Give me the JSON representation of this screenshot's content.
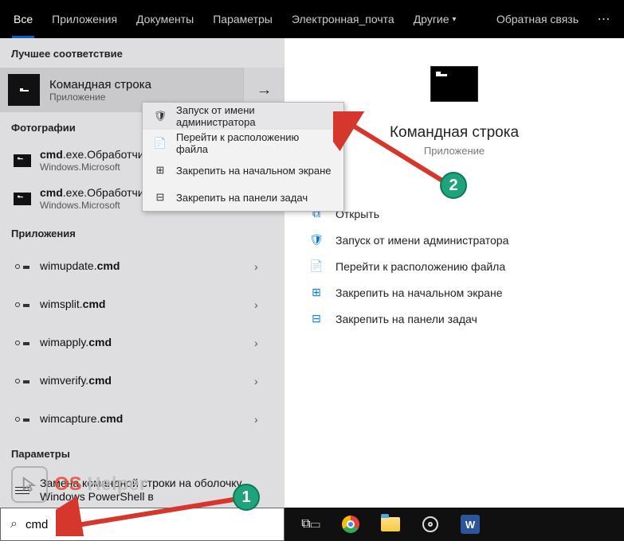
{
  "topbar": {
    "tabs": [
      "Все",
      "Приложения",
      "Документы",
      "Параметры",
      "Электронная_почта",
      "Другие"
    ],
    "feedback": "Обратная связь"
  },
  "sections": {
    "best": "Лучшее соответствие",
    "photos": "Фотографии",
    "apps": "Приложения",
    "settings": "Параметры"
  },
  "best": {
    "title": "Командная строка",
    "subtitle": "Приложение"
  },
  "photos": [
    {
      "t1": "cmd",
      "t2": ".exe.Обработчи",
      "sub": "Windows.Microsoft"
    },
    {
      "t1": "cmd",
      "t2": ".exe.Обработчик команд",
      "sub": "Windows.Microsoft"
    }
  ],
  "apps": [
    {
      "p": "wimupdate.",
      "s": "cmd"
    },
    {
      "p": "wimsplit.",
      "s": "cmd"
    },
    {
      "p": "wimapply.",
      "s": "cmd"
    },
    {
      "p": "wimverify.",
      "s": "cmd"
    },
    {
      "p": "wimcapture.",
      "s": "cmd"
    }
  ],
  "setting_item": "Замена командной строки на оболочку Windows PowerShell в",
  "context_menu": [
    "Запуск от имени администратора",
    "Перейти к расположению файла",
    "Закрепить на начальном экране",
    "Закрепить на панели задач"
  ],
  "preview": {
    "title": "Командная строка",
    "type": "Приложение",
    "actions": [
      "Открыть",
      "Запуск от имени администратора",
      "Перейти к расположению файла",
      "Закрепить на начальном экране",
      "Закрепить на панели задач"
    ]
  },
  "search": {
    "value": "cmd"
  },
  "watermark": {
    "a": "OS",
    "b": " Helper"
  },
  "word_letter": "W",
  "badges": {
    "one": "1",
    "two": "2"
  }
}
